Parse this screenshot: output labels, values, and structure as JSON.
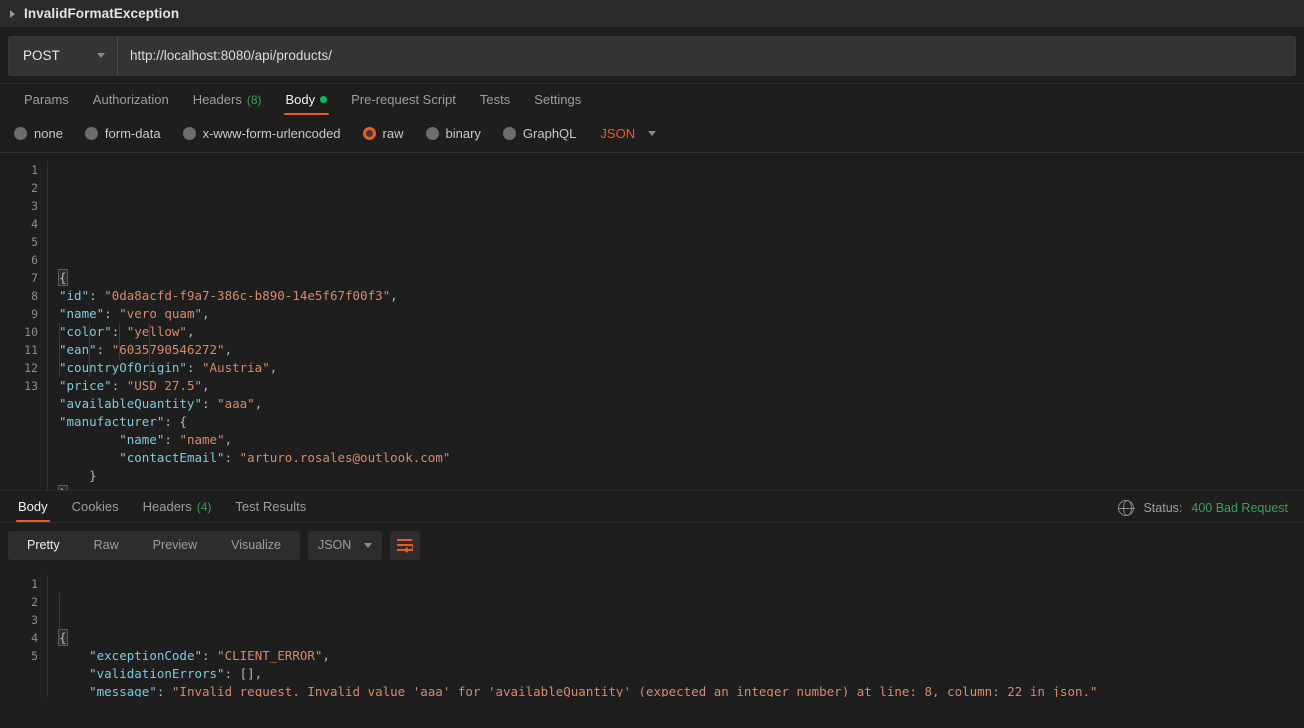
{
  "exception_bar": {
    "caret_icon": "triangle-right-icon",
    "title": "InvalidFormatException"
  },
  "request": {
    "method": "POST",
    "method_caret_icon": "chevron-down-icon",
    "url": "http://localhost:8080/api/products/",
    "tabs": [
      {
        "label": "Params",
        "count": "",
        "active": false,
        "dot": false
      },
      {
        "label": "Authorization",
        "count": "",
        "active": false,
        "dot": false
      },
      {
        "label": "Headers",
        "count": "(8)",
        "active": false,
        "dot": false
      },
      {
        "label": "Body",
        "count": "",
        "active": true,
        "dot": true
      },
      {
        "label": "Pre-request Script",
        "count": "",
        "active": false,
        "dot": false
      },
      {
        "label": "Tests",
        "count": "",
        "active": false,
        "dot": false
      },
      {
        "label": "Settings",
        "count": "",
        "active": false,
        "dot": false
      }
    ],
    "body_types": [
      {
        "label": "none",
        "selected": false
      },
      {
        "label": "form-data",
        "selected": false
      },
      {
        "label": "x-www-form-urlencoded",
        "selected": false
      },
      {
        "label": "raw",
        "selected": true
      },
      {
        "label": "binary",
        "selected": false
      },
      {
        "label": "GraphQL",
        "selected": false
      }
    ],
    "body_format": "JSON",
    "body_format_caret_icon": "chevron-down-icon",
    "body_lines": [
      {
        "n": "1",
        "segs": [
          {
            "t": "{",
            "c": "p brace-hl"
          }
        ]
      },
      {
        "n": "2",
        "segs": [
          {
            "t": "\"id\"",
            "c": "k"
          },
          {
            "t": ": ",
            "c": "p"
          },
          {
            "t": "\"0da8acfd-f9a7-386c-b890-14e5f67f00f3\"",
            "c": "s"
          },
          {
            "t": ",",
            "c": "p"
          }
        ]
      },
      {
        "n": "3",
        "segs": [
          {
            "t": "\"name\"",
            "c": "k"
          },
          {
            "t": ": ",
            "c": "p"
          },
          {
            "t": "\"vero quam\"",
            "c": "s"
          },
          {
            "t": ",",
            "c": "p"
          }
        ]
      },
      {
        "n": "4",
        "segs": [
          {
            "t": "\"color\"",
            "c": "k"
          },
          {
            "t": ": ",
            "c": "p"
          },
          {
            "t": "\"yellow\"",
            "c": "s"
          },
          {
            "t": ",",
            "c": "p"
          }
        ]
      },
      {
        "n": "5",
        "segs": [
          {
            "t": "\"ean\"",
            "c": "k"
          },
          {
            "t": ": ",
            "c": "p"
          },
          {
            "t": "\"6035790546272\"",
            "c": "s"
          },
          {
            "t": ",",
            "c": "p"
          }
        ]
      },
      {
        "n": "6",
        "segs": [
          {
            "t": "\"countryOfOrigin\"",
            "c": "k"
          },
          {
            "t": ": ",
            "c": "p"
          },
          {
            "t": "\"Austria\"",
            "c": "s"
          },
          {
            "t": ",",
            "c": "p"
          }
        ]
      },
      {
        "n": "7",
        "segs": [
          {
            "t": "\"price\"",
            "c": "k"
          },
          {
            "t": ": ",
            "c": "p"
          },
          {
            "t": "\"USD 27.5\"",
            "c": "s"
          },
          {
            "t": ",",
            "c": "p"
          }
        ]
      },
      {
        "n": "8",
        "segs": [
          {
            "t": "\"availableQuantity\"",
            "c": "k"
          },
          {
            "t": ": ",
            "c": "p"
          },
          {
            "t": "\"aaa\"",
            "c": "s"
          },
          {
            "t": ",",
            "c": "p"
          }
        ]
      },
      {
        "n": "9",
        "segs": [
          {
            "t": "\"manufacturer\"",
            "c": "k"
          },
          {
            "t": ": {",
            "c": "p"
          }
        ]
      },
      {
        "n": "10",
        "segs": [
          {
            "t": "        ",
            "c": "p"
          },
          {
            "t": "\"name\"",
            "c": "k"
          },
          {
            "t": ": ",
            "c": "p"
          },
          {
            "t": "\"name\"",
            "c": "s"
          },
          {
            "t": ",",
            "c": "p"
          }
        ]
      },
      {
        "n": "11",
        "segs": [
          {
            "t": "        ",
            "c": "p"
          },
          {
            "t": "\"contactEmail\"",
            "c": "k"
          },
          {
            "t": ": ",
            "c": "p"
          },
          {
            "t": "\"arturo.rosales@outlook.com\"",
            "c": "s"
          }
        ]
      },
      {
        "n": "12",
        "segs": [
          {
            "t": "    ",
            "c": "p"
          },
          {
            "t": "}",
            "c": "p"
          }
        ]
      },
      {
        "n": "13",
        "segs": [
          {
            "t": "}",
            "c": "p brace-hl"
          }
        ]
      }
    ]
  },
  "response": {
    "tabs": [
      {
        "label": "Body",
        "count": "",
        "active": true
      },
      {
        "label": "Cookies",
        "count": "",
        "active": false
      },
      {
        "label": "Headers",
        "count": "(4)",
        "active": false
      },
      {
        "label": "Test Results",
        "count": "",
        "active": false
      }
    ],
    "globe_icon": "globe-icon",
    "status_label": "Status:",
    "status_value": "400 Bad Request",
    "view_modes": [
      {
        "label": "Pretty",
        "active": true
      },
      {
        "label": "Raw",
        "active": false
      },
      {
        "label": "Preview",
        "active": false
      },
      {
        "label": "Visualize",
        "active": false
      }
    ],
    "format": "JSON",
    "format_caret_icon": "chevron-down-icon",
    "wrap_icon": "word-wrap-icon",
    "body_lines": [
      {
        "n": "1",
        "segs": [
          {
            "t": "{",
            "c": "p brace-hl"
          }
        ]
      },
      {
        "n": "2",
        "segs": [
          {
            "t": "    ",
            "c": "p"
          },
          {
            "t": "\"exceptionCode\"",
            "c": "k"
          },
          {
            "t": ": ",
            "c": "p"
          },
          {
            "t": "\"CLIENT_ERROR\"",
            "c": "s"
          },
          {
            "t": ",",
            "c": "p"
          }
        ]
      },
      {
        "n": "3",
        "segs": [
          {
            "t": "    ",
            "c": "p"
          },
          {
            "t": "\"validationErrors\"",
            "c": "k"
          },
          {
            "t": ": [],",
            "c": "p"
          }
        ]
      },
      {
        "n": "4",
        "segs": [
          {
            "t": "    ",
            "c": "p"
          },
          {
            "t": "\"message\"",
            "c": "k"
          },
          {
            "t": ": ",
            "c": "p"
          },
          {
            "t": "\"Invalid request. Invalid value 'aaa' for 'availableQuantity' (expected an integer number) at line: 8, column: 22 in json.\"",
            "c": "s"
          }
        ]
      },
      {
        "n": "5",
        "segs": [
          {
            "t": "}",
            "c": "p brace-hl"
          }
        ]
      }
    ]
  },
  "colors": {
    "accent": "#ef5b25",
    "green": "#3aa05a",
    "bg": "#1e1e1e",
    "panel": "#2a2a2a",
    "key": "#7fc8df",
    "string": "#d78a6a"
  }
}
